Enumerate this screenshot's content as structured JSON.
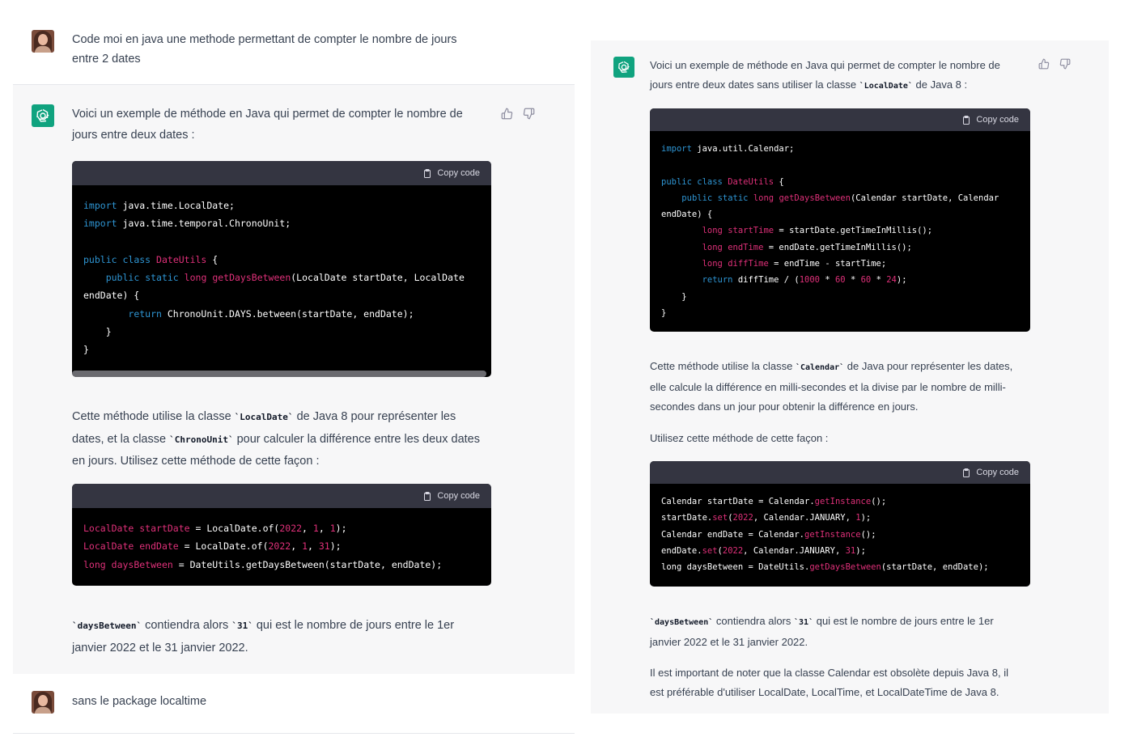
{
  "left_panel": {
    "user_message_1": "Code moi en java une methode permettant de compter le nombre de jours entre 2 dates",
    "bot_intro_1": "Voici un exemple de méthode en Java qui permet de compter le nombre de",
    "bot_intro_2": "jours entre deux dates :",
    "copy_code_label": "Copy code",
    "explain_1a": "Cette méthode utilise la classe ",
    "explain_1_code1": "`LocalDate`",
    "explain_1b": " de Java 8 pour représenter les",
    "explain_2a": "dates, et la classe ",
    "explain_2_code": "`ChronoUnit`",
    "explain_2b": " pour calculer la différence entre les deux dates",
    "explain_3": "en jours. Utilisez cette méthode de cette façon :",
    "result_code1": "`daysBetween`",
    "result_a": " contiendra alors ",
    "result_code2": "`31`",
    "result_b": " qui est le nombre de jours entre le 1er",
    "result_2": "janvier 2022 et le 31 janvier 2022.",
    "user_message_2": "sans le package localtime"
  },
  "right_panel": {
    "bot_intro_1a": "Voici un exemple de méthode en Java qui permet de compter le nombre de",
    "bot_intro_2a": "jours entre deux dates sans utiliser la classe ",
    "bot_intro_code": "`LocalDate`",
    "bot_intro_2b": " de Java 8 :",
    "copy_code_label": "Copy code",
    "explain_1a": "Cette méthode utilise la classe ",
    "explain_1_code": "`Calendar`",
    "explain_1b": " de Java pour représenter les dates,",
    "explain_2": "elle calcule la différence en milli-secondes et la divise par le nombre de milli-",
    "explain_3": "secondes dans un jour pour obtenir la différence en jours.",
    "usage": "Utilisez cette méthode de cette façon :",
    "result_code1": "`daysBetween`",
    "result_a": " contiendra alors ",
    "result_code2": "`31`",
    "result_b": " qui est le nombre de jours entre le 1er",
    "result_2": "janvier 2022 et le 31 janvier 2022.",
    "note_1": "Il est important de noter que la classe Calendar est obsolète depuis Java 8, il",
    "note_2": "est préférable d'utiliser LocalDate, LocalTime, et LocalDateTime de Java 8."
  },
  "colors": {
    "bot_accent": "#10a37f",
    "code_keyword": "#2e95d3",
    "code_type": "#df3079",
    "code_header": "#343541",
    "bot_background": "#f7f7f8"
  },
  "icons": [
    "user-avatar",
    "chatgpt-logo-icon",
    "clipboard-icon",
    "thumbs-up-icon",
    "thumbs-down-icon"
  ]
}
